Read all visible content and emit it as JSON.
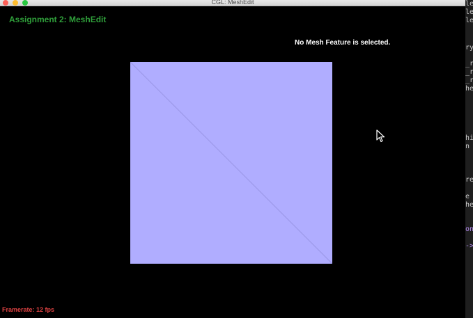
{
  "window": {
    "title": "CGL: MeshEdit"
  },
  "app": {
    "title": "Assignment 2: MeshEdit",
    "status": "No Mesh Feature is selected.",
    "framerate": "Framerate: 12 fps"
  },
  "colors": {
    "app_title": "#2f9e3a",
    "framerate": "#e04343",
    "mesh_fill": "#b0adff",
    "mesh_edge": "#9a97e6"
  },
  "side_code": {
    "lines": [
      "le",
      "le",
      "le",
      "ry",
      "_r",
      "_r",
      "_r",
      "he",
      "hi",
      " n",
      "re",
      "e ",
      "he",
      "on",
      "->"
    ]
  }
}
